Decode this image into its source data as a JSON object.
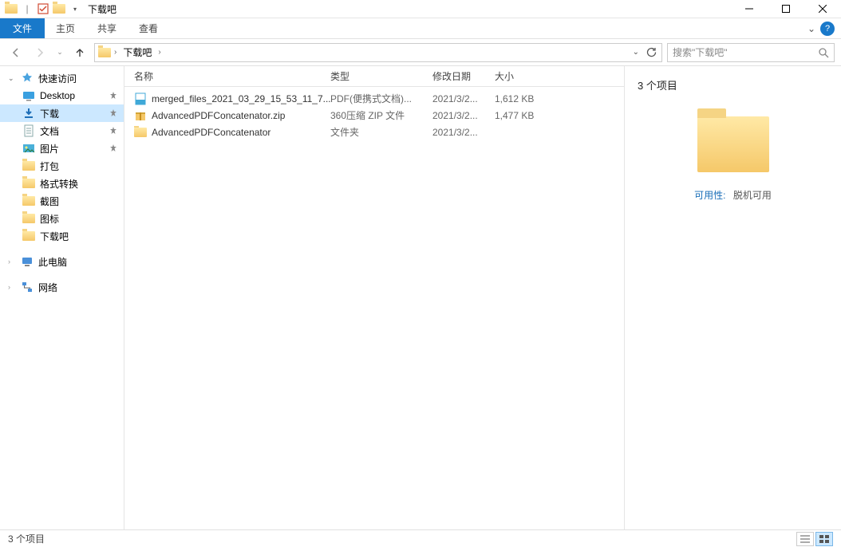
{
  "window": {
    "title": "下载吧"
  },
  "ribbon": {
    "file": "文件",
    "tabs": [
      "主页",
      "共享",
      "查看"
    ]
  },
  "nav": {
    "crumbs": [
      "下载吧"
    ],
    "refresh_label": "刷新",
    "search_placeholder": "搜索\"下载吧\""
  },
  "sidebar": {
    "quick_access": "快速访问",
    "items": [
      {
        "label": "Desktop",
        "pinned": true,
        "icon": "desktop"
      },
      {
        "label": "下载",
        "pinned": true,
        "icon": "download",
        "active": true
      },
      {
        "label": "文档",
        "pinned": true,
        "icon": "document"
      },
      {
        "label": "图片",
        "pinned": true,
        "icon": "picture"
      },
      {
        "label": "打包",
        "pinned": false,
        "icon": "folder"
      },
      {
        "label": "格式转换",
        "pinned": false,
        "icon": "folder"
      },
      {
        "label": "截图",
        "pinned": false,
        "icon": "folder"
      },
      {
        "label": "图标",
        "pinned": false,
        "icon": "folder"
      },
      {
        "label": "下载吧",
        "pinned": false,
        "icon": "folder"
      }
    ],
    "this_pc": "此电脑",
    "network": "网络"
  },
  "columns": {
    "name": "名称",
    "type": "类型",
    "date": "修改日期",
    "size": "大小"
  },
  "files": [
    {
      "name": "merged_files_2021_03_29_15_53_11_7...",
      "type": "PDF(便携式文档)...",
      "date": "2021/3/2...",
      "size": "1,612 KB",
      "icon": "pdf"
    },
    {
      "name": "AdvancedPDFConcatenator.zip",
      "type": "360压缩 ZIP 文件",
      "date": "2021/3/2...",
      "size": "1,477 KB",
      "icon": "zip"
    },
    {
      "name": "AdvancedPDFConcatenator",
      "type": "文件夹",
      "date": "2021/3/2...",
      "size": "",
      "icon": "folder"
    }
  ],
  "preview": {
    "title": "3 个项目",
    "meta_key": "可用性:",
    "meta_value": "脱机可用"
  },
  "statusbar": {
    "text": "3 个项目"
  }
}
